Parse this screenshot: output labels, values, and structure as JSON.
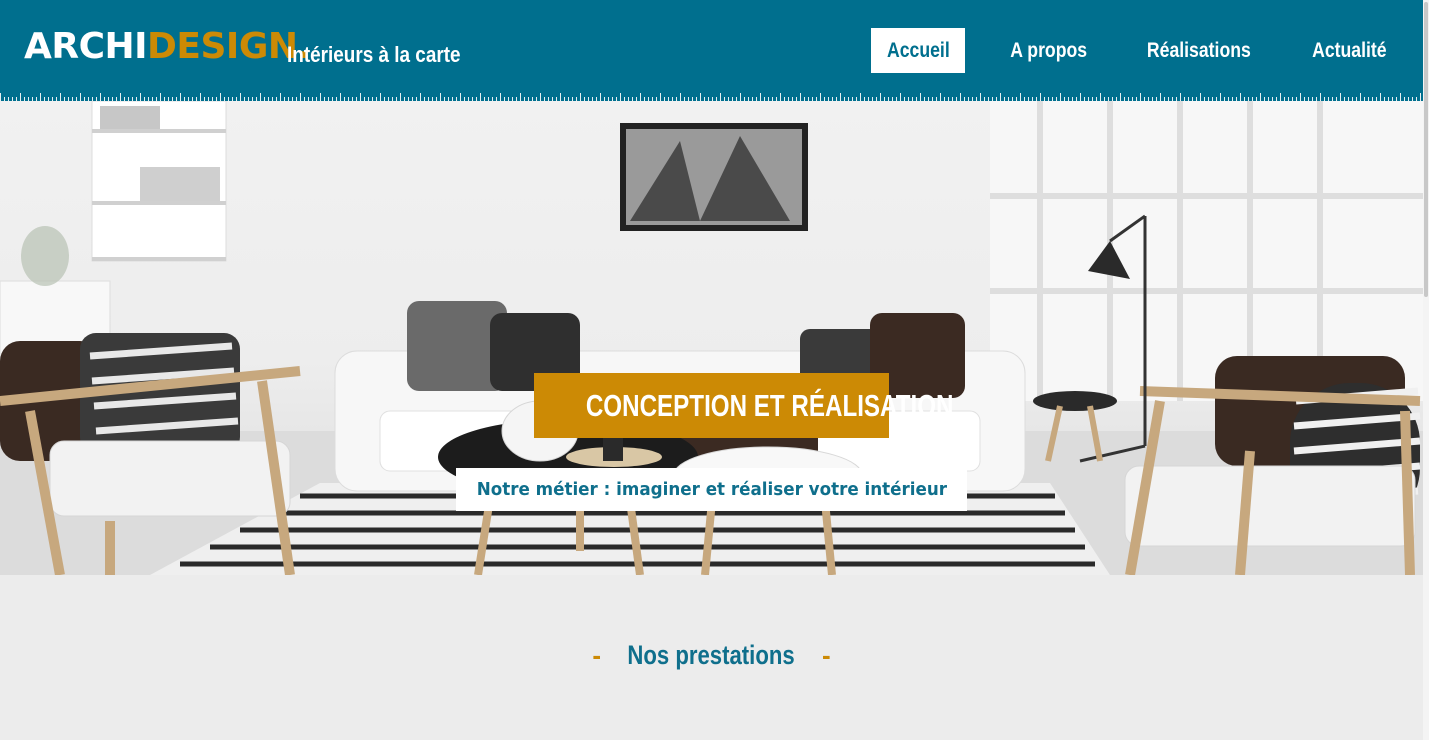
{
  "brand": {
    "name_part1": "ARCHI",
    "name_part2": "DESIGN.",
    "tagline": "Intérieurs à la carte"
  },
  "nav": {
    "items": [
      {
        "label": "Accueil",
        "active": true
      },
      {
        "label": "A propos",
        "active": false
      },
      {
        "label": "Réalisations",
        "active": false
      },
      {
        "label": "Actualité",
        "active": false
      }
    ]
  },
  "hero": {
    "title": "CONCEPTION ET RÉALISATION",
    "subtitle": "Notre métier : imaginer et réaliser votre intérieur",
    "image": "living-room-photo"
  },
  "section": {
    "title": "Nos prestations",
    "dash": "-"
  },
  "colors": {
    "primary": "#006f8e",
    "accent": "#cc8a05",
    "background": "#ececec",
    "white": "#ffffff"
  }
}
